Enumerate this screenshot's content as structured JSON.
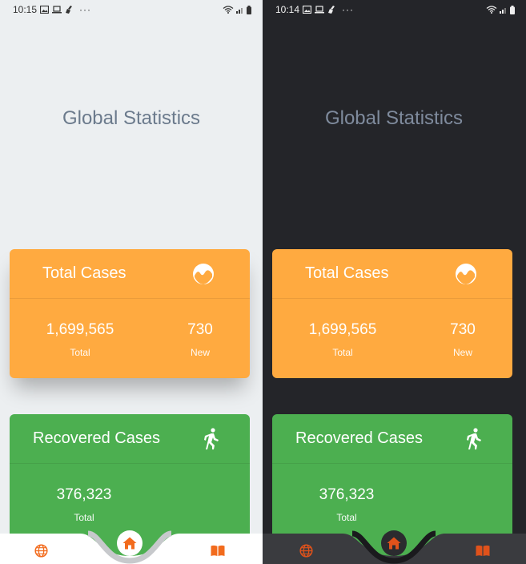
{
  "screens": [
    {
      "theme": "light",
      "status_time": "10:15",
      "status_more": "···",
      "title": "Global Statistics",
      "total_cases": {
        "title": "Total Cases",
        "total_value": "1,699,565",
        "total_label": "Total",
        "new_value": "730",
        "new_label": "New"
      },
      "recovered_cases": {
        "title": "Recovered Cases",
        "total_value": "376,323",
        "total_label": "Total"
      }
    },
    {
      "theme": "dark",
      "status_time": "10:14",
      "status_more": "···",
      "title": "Global Statistics",
      "total_cases": {
        "title": "Total Cases",
        "total_value": "1,699,565",
        "total_label": "Total",
        "new_value": "730",
        "new_label": "New"
      },
      "recovered_cases": {
        "title": "Recovered Cases",
        "total_value": "376,323",
        "total_label": "Total"
      }
    }
  ],
  "nav": {
    "items": [
      {
        "icon": "globe-icon"
      },
      {
        "icon": "home-icon",
        "active": true
      },
      {
        "icon": "book-icon"
      }
    ]
  },
  "colors": {
    "total_card": "#ffaa40",
    "recovered_card": "#4caf50",
    "accent": "#f26b1d",
    "light_bg": "#eceff1",
    "dark_bg": "#242529"
  }
}
